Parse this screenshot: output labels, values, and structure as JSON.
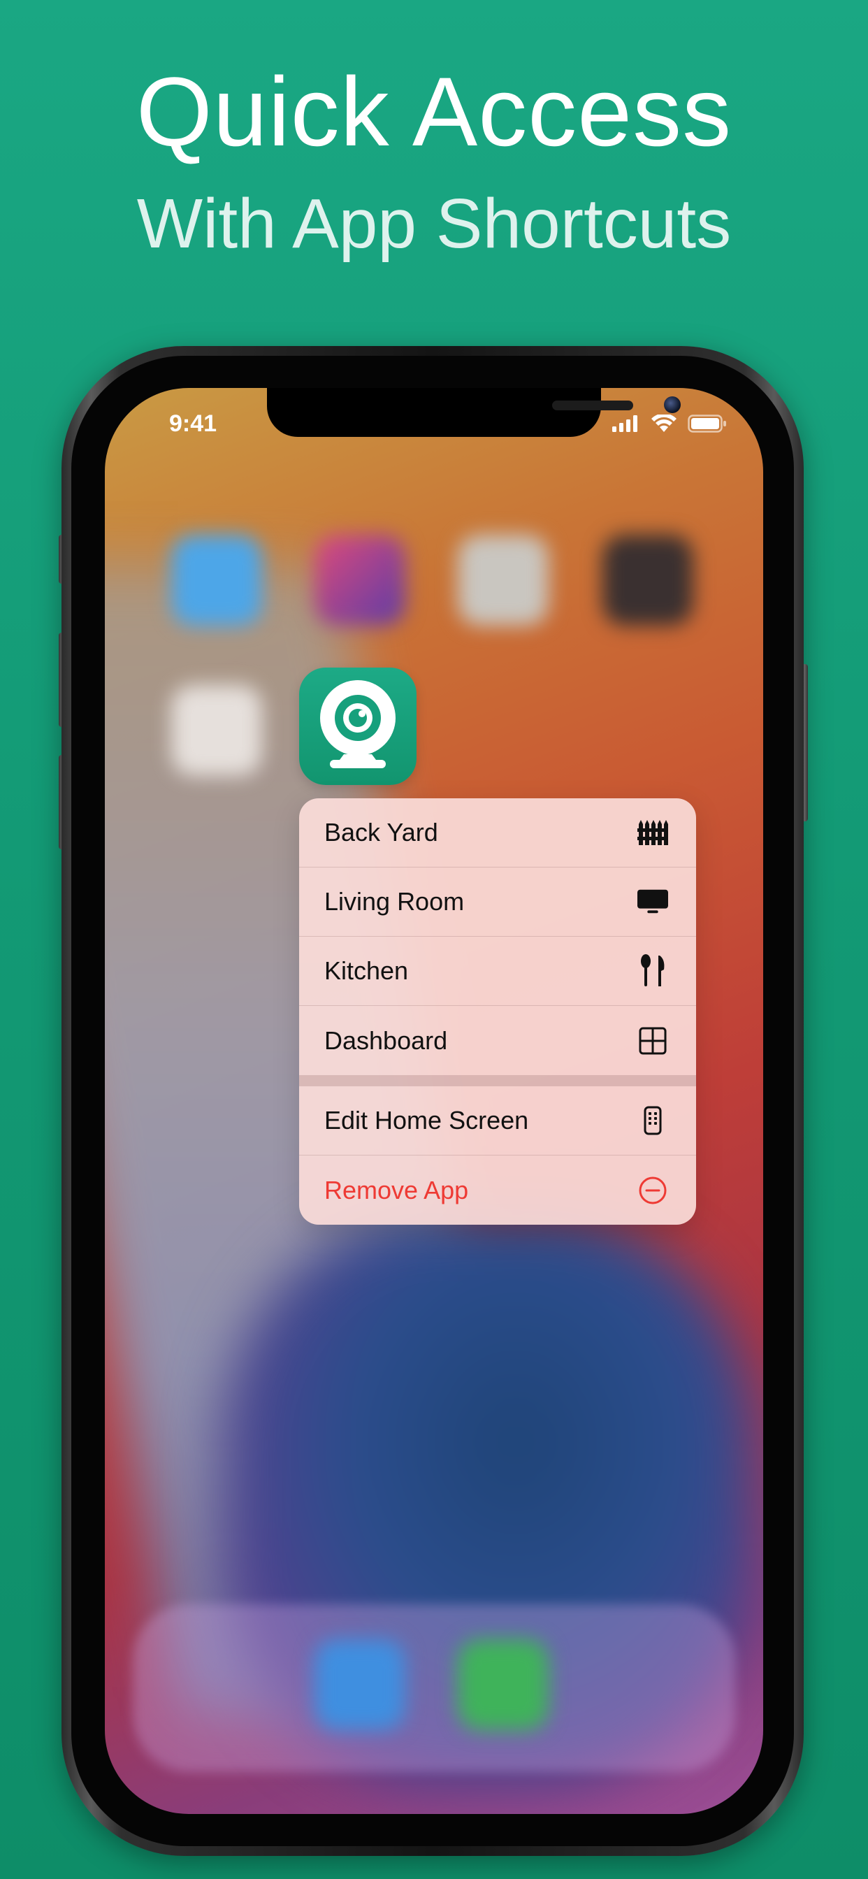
{
  "promo": {
    "headline": "Quick Access",
    "subheadline": "With App Shortcuts"
  },
  "status_bar": {
    "time": "9:41",
    "icons": [
      "cellular-signal-icon",
      "wifi-icon",
      "battery-icon"
    ]
  },
  "app": {
    "icon": "webcam-app-icon",
    "color": "#18a07c"
  },
  "context_menu": {
    "shortcuts": [
      {
        "label": "Back Yard",
        "icon": "fence-icon"
      },
      {
        "label": "Living Room",
        "icon": "tv-icon"
      },
      {
        "label": "Kitchen",
        "icon": "fork-knife-icon"
      },
      {
        "label": "Dashboard",
        "icon": "grid-icon"
      }
    ],
    "system_actions": [
      {
        "label": "Edit Home Screen",
        "icon": "phone-apps-icon"
      },
      {
        "label": "Remove App",
        "icon": "minus-circle-icon",
        "color": "#ee3a34"
      }
    ]
  },
  "colors": {
    "background": "#16a07c",
    "destructive": "#ee3a34"
  }
}
